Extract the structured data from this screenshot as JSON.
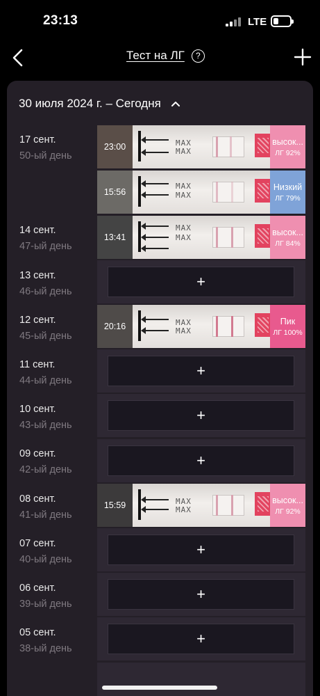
{
  "status_bar": {
    "time": "23:13",
    "network": "LTE"
  },
  "nav": {
    "title": "Тест на ЛГ",
    "help": "?"
  },
  "header": {
    "period": "30 июля 2024 г. – Сегодня"
  },
  "colors": {
    "high": "#ef8fb0",
    "low": "#7fa3d8",
    "peak": "#e85a8e",
    "card": "#241f27"
  },
  "days": [
    {
      "date": "17 сент.",
      "cycle_day": "50-ый день"
    },
    {
      "date": "14 сент.",
      "cycle_day": "47-ый день"
    },
    {
      "date": "13 сент.",
      "cycle_day": "46-ый день"
    },
    {
      "date": "12 сент.",
      "cycle_day": "45-ый день"
    },
    {
      "date": "11 сент.",
      "cycle_day": "44-ый день"
    },
    {
      "date": "10 сент.",
      "cycle_day": "43-ый день"
    },
    {
      "date": "09 сент.",
      "cycle_day": "42-ый день"
    },
    {
      "date": "08 сент.",
      "cycle_day": "41-ый день"
    },
    {
      "date": "07 сент.",
      "cycle_day": "40-ый день"
    },
    {
      "date": "06 сент.",
      "cycle_day": "39-ый день"
    },
    {
      "date": "05 сент.",
      "cycle_day": "38-ый день"
    }
  ],
  "tests": [
    {
      "time": "23:00",
      "level": "высок...",
      "lh": "ЛГ 92%",
      "strip_text": "MAX"
    },
    {
      "time": "15:56",
      "level": "Низкий",
      "lh": "ЛГ 79%",
      "strip_text": "MAX"
    },
    {
      "time": "13:41",
      "level": "высок...",
      "lh": "ЛГ 84%",
      "strip_text": "MAX"
    },
    {
      "time": "20:16",
      "level": "Пик",
      "lh": "ЛГ 100%",
      "strip_text": "MAX"
    },
    {
      "time": "15:59",
      "level": "высок...",
      "lh": "ЛГ 92%",
      "strip_text": "MAX"
    }
  ],
  "add_label": "+"
}
